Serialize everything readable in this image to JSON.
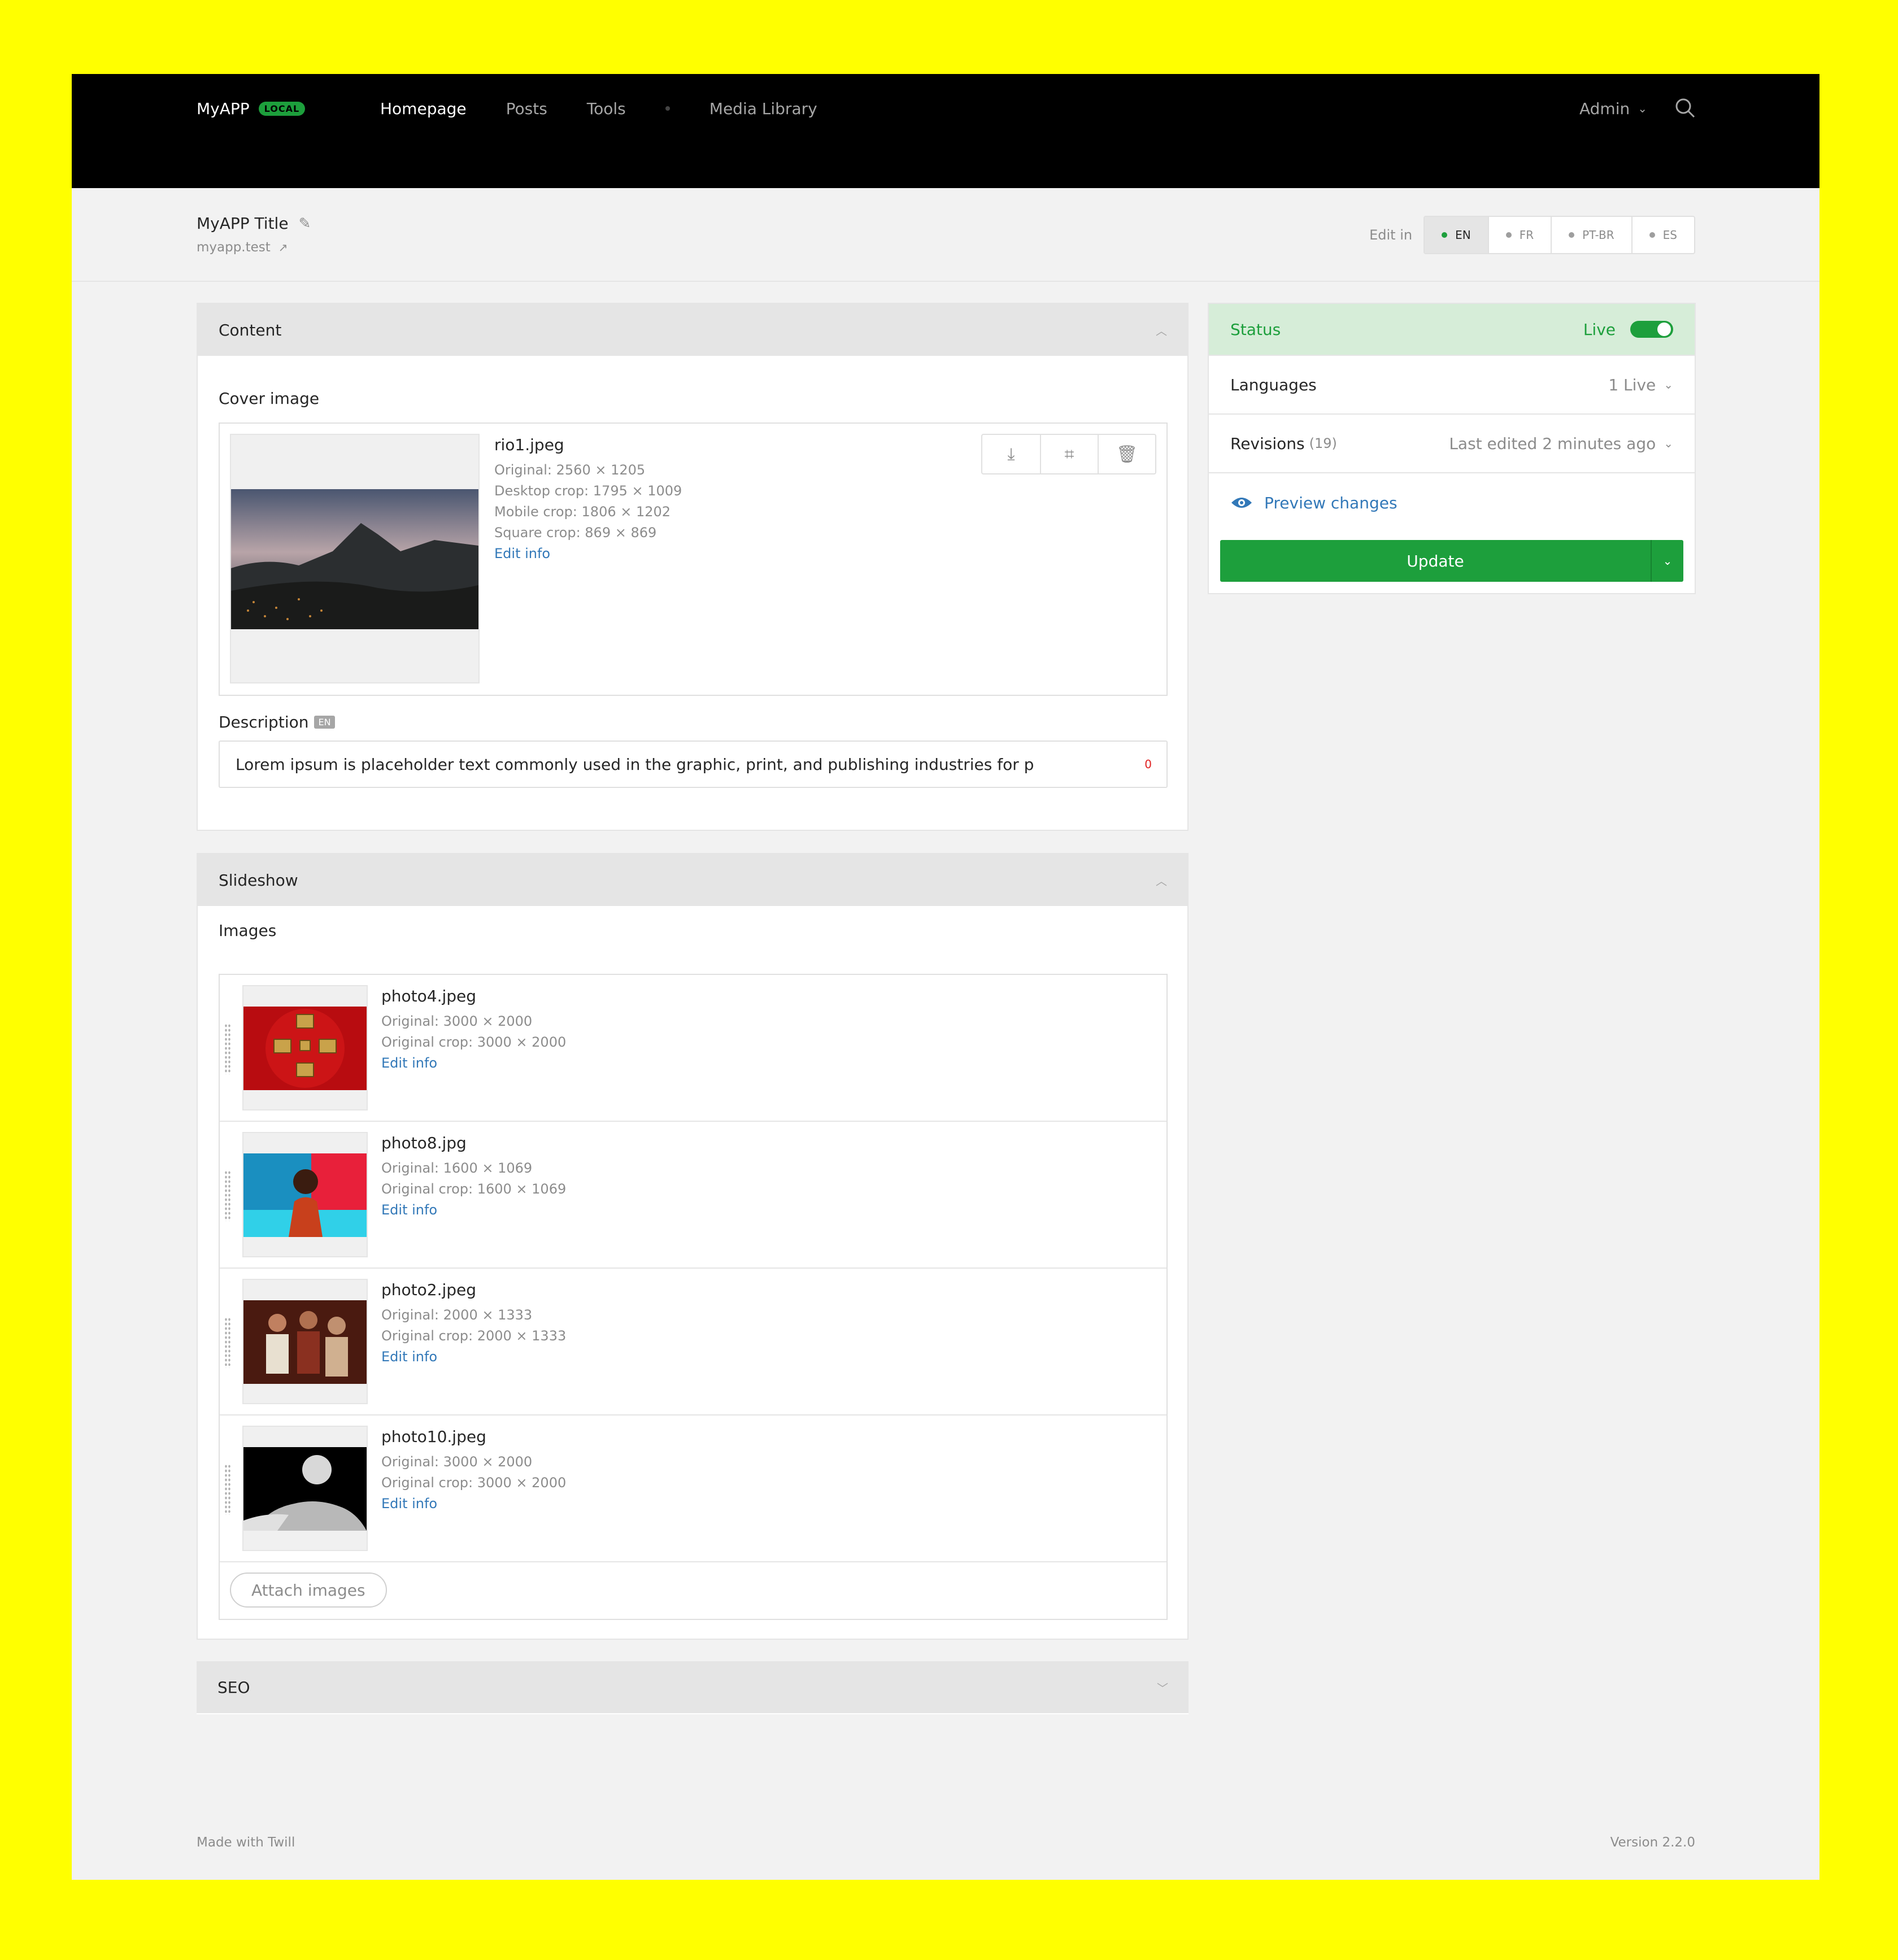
{
  "header": {
    "brand": "MyAPP",
    "env_badge": "LOCAL",
    "nav": [
      "Homepage",
      "Posts",
      "Tools",
      "Media Library"
    ],
    "user": "Admin"
  },
  "titlebar": {
    "title": "MyAPP Title",
    "permalink": "myapp.test",
    "edit_in_label": "Edit in",
    "languages": [
      "EN",
      "FR",
      "PT-BR",
      "ES"
    ]
  },
  "content_panel": {
    "title": "Content",
    "cover_label": "Cover image",
    "cover": {
      "filename": "rio1.jpeg",
      "original": "Original: 2560 × 1205",
      "desktop": "Desktop crop: 1795 × 1009",
      "mobile": "Mobile crop: 1806 × 1202",
      "square": "Square crop: 869 × 869",
      "edit": "Edit info"
    },
    "description_label": "Description",
    "description_lang": "EN",
    "description_value": "Lorem ipsum is placeholder text commonly used in the graphic, print, and publishing industries for p",
    "char_count": "0"
  },
  "slideshow_panel": {
    "title": "Slideshow",
    "images_label": "Images",
    "images": [
      {
        "filename": "photo4.jpeg",
        "original": "Original: 3000 × 2000",
        "crop": "Original crop: 3000 × 2000",
        "edit": "Edit info"
      },
      {
        "filename": "photo8.jpg",
        "original": "Original: 1600 × 1069",
        "crop": "Original crop: 1600 × 1069",
        "edit": "Edit info"
      },
      {
        "filename": "photo2.jpeg",
        "original": "Original: 2000 × 1333",
        "crop": "Original crop: 2000 × 1333",
        "edit": "Edit info"
      },
      {
        "filename": "photo10.jpeg",
        "original": "Original: 3000 × 2000",
        "crop": "Original crop: 3000 × 2000",
        "edit": "Edit info"
      }
    ],
    "attach_label": "Attach images"
  },
  "seo_panel": {
    "title": "SEO"
  },
  "sidebar": {
    "status_label": "Status",
    "status_value": "Live",
    "languages_label": "Languages",
    "languages_value": "1 Live",
    "revisions_label": "Revisions",
    "revisions_count": "(19)",
    "revisions_value": "Last edited 2 minutes ago",
    "preview_label": "Preview changes",
    "update_label": "Update"
  },
  "footer": {
    "left": "Made with Twill",
    "right": "Version 2.2.0"
  },
  "colors": {
    "accent": "#1d9f3c",
    "link": "#3278b8",
    "topbar": "#000000",
    "frame": "#ffff00"
  }
}
